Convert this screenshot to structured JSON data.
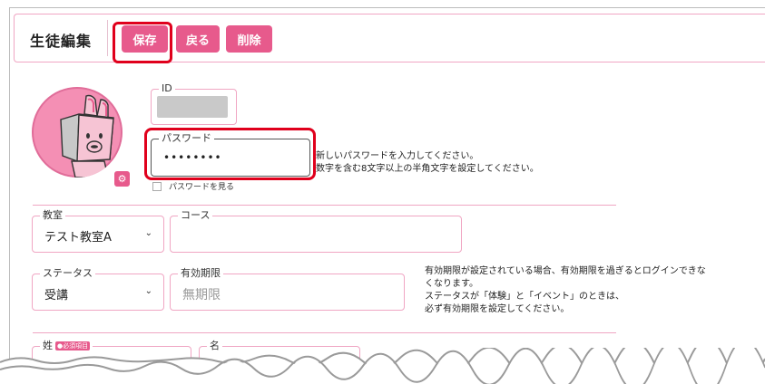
{
  "header": {
    "title": "生徒編集",
    "buttons": {
      "save": "保存",
      "back": "戻る",
      "delete": "削除"
    }
  },
  "avatar": {
    "icon": "mascot-avatar",
    "edit_icon": "gear-icon"
  },
  "fields": {
    "id": {
      "label": "ID"
    },
    "password": {
      "label": "パスワード",
      "value": "••••••••"
    },
    "show_password": {
      "label": "パスワードを見る",
      "checked": false
    },
    "classroom": {
      "label": "教室",
      "value": "テスト教室A"
    },
    "course": {
      "label": "コース",
      "value": ""
    },
    "status": {
      "label": "ステータス",
      "value": "受講"
    },
    "expiration": {
      "label": "有効期限",
      "placeholder": "無期限"
    },
    "last_name": {
      "label": "姓",
      "required": "●必須項目"
    },
    "first_name": {
      "label": "名"
    }
  },
  "notes": {
    "password": [
      "新しいパスワードを入力してください。",
      "数字を含む8文字以上の半角文字を設定してください。"
    ],
    "expiration": [
      "有効期限が設定されている場合、有効期限を過ぎるとログインできな",
      "くなります。",
      "ステータスが「体験」と「イベント」のときは、",
      "必ず有効期限を設定してください。"
    ]
  },
  "colors": {
    "accent": "#e75a8c",
    "border": "#f0a6c3",
    "highlight": "#e0001c"
  }
}
